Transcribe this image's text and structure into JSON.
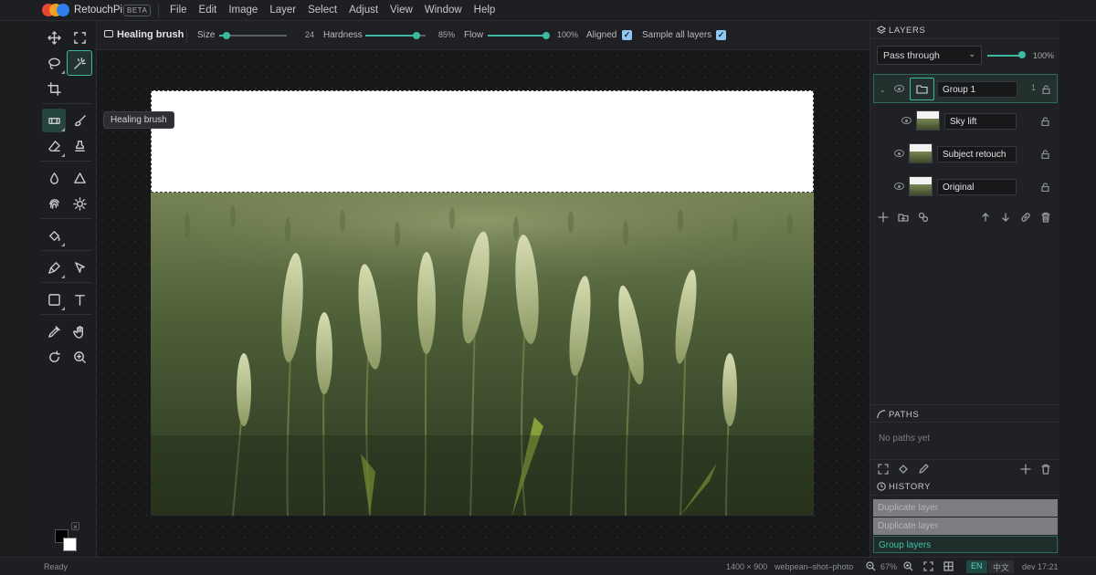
{
  "app": {
    "name": "RetouchPi",
    "badge": "BETA"
  },
  "menu": [
    "File",
    "Edit",
    "Image",
    "Layer",
    "Select",
    "Adjust",
    "View",
    "Window",
    "Help"
  ],
  "options": {
    "tool_name": "Healing brush",
    "size_label": "Size",
    "size_value": "24",
    "hardness_label": "Hardness",
    "hardness_value": "85%",
    "flow_label": "Flow",
    "flow_value": "100%",
    "aligned_label": "Aligned",
    "aligned_checked": true,
    "sample_label": "Sample all layers",
    "sample_checked": true
  },
  "tooltip": "Healing brush",
  "layers": {
    "title": "LAYERS",
    "blend_mode": "Pass through",
    "opacity": "100%",
    "items": [
      {
        "name": "Group 1",
        "count": "1",
        "type": "group"
      },
      {
        "name": "Sky lift",
        "type": "layer"
      },
      {
        "name": "Subject retouch",
        "type": "layer"
      },
      {
        "name": "Original",
        "type": "layer"
      }
    ]
  },
  "paths": {
    "title": "PATHS",
    "empty": "No paths yet"
  },
  "history": {
    "title": "HISTORY",
    "items": [
      "Duplicate layer",
      "Duplicate layer",
      "Group layers"
    ]
  },
  "status": {
    "state": "Ready",
    "dimensions": "1400 × 900",
    "filename": "webpean–shot–photo",
    "zoom": "67%",
    "lang_en": "EN",
    "lang_zh": "中文",
    "build": "dev 17:21"
  },
  "colors": {
    "accent": "#3fb8a1",
    "foreground": "#000000",
    "background": "#ffffff"
  }
}
